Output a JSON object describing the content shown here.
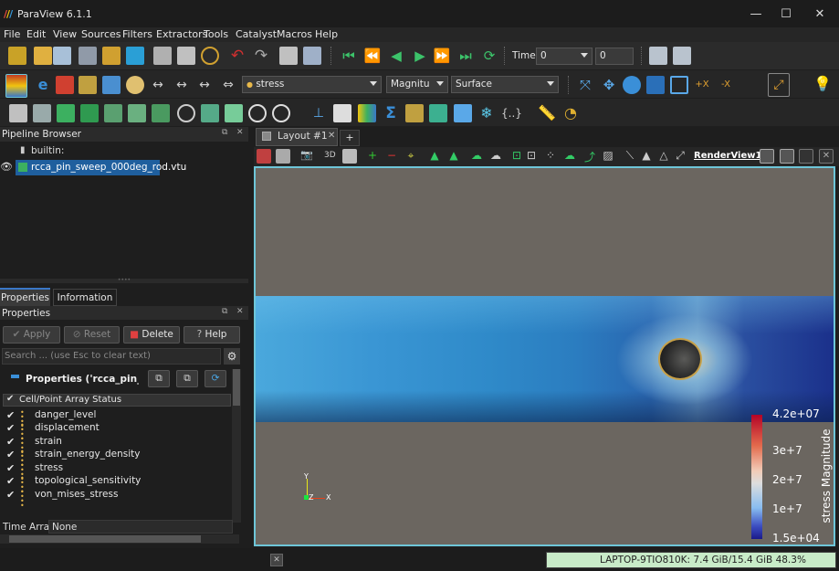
{
  "window": {
    "title": "ParaView 6.1.1",
    "logo": "///",
    "minimize": "—",
    "maximize": "☐",
    "close": "✕"
  },
  "menu": [
    "File",
    "Edit",
    "View",
    "Sources",
    "Filters",
    "Extractors",
    "Tools",
    "Catalyst",
    "Macros",
    "Help"
  ],
  "toolbar": {
    "time_label": "Time:",
    "time_value": "0",
    "timestep_value": "0",
    "array_combo": "stress",
    "component_combo": "Magnitu",
    "representation_combo": "Surface"
  },
  "pipeline": {
    "title": "Pipeline Browser",
    "root": "builtin:",
    "item": "rcca_pin_sweep_000deg_rod.vtu"
  },
  "properties": {
    "tabs": [
      "Properties",
      "Information"
    ],
    "title": "Properties",
    "apply": "Apply",
    "reset": "Reset",
    "delete": "Delete",
    "help": "Help",
    "search_placeholder": "Search ... (use Esc to clear text)",
    "section_title": "Properties ('rcca_pin_sweep",
    "array_header": "Cell/Point Array Status",
    "arrays": [
      "danger_level",
      "displacement",
      "strain",
      "strain_energy_density",
      "stress",
      "topological_sensitivity",
      "von_mises_stress"
    ],
    "time_array_label": "Time Array",
    "time_array_value": "None"
  },
  "layout": {
    "tab_label": "Layout #1",
    "add_tab": "+",
    "render_view": "RenderView1",
    "view_3d": "3D"
  },
  "colorbar": {
    "title": "stress Magnitude",
    "ticks": [
      "4.2e+07",
      "3e+7",
      "2e+7",
      "1e+7",
      "1.5e+04"
    ]
  },
  "axes": {
    "x": "X",
    "y": "Y",
    "z": "Z"
  },
  "status": {
    "memory": "LAPTOP-9TIO810K: 7.4 GiB/15.4 GiB 48.3%",
    "memory_fraction": 0.483
  },
  "colors": {
    "background": "#1e1e1e",
    "render_bg": "#6b6660",
    "selection": "#1f5f9e",
    "accent_border": "#6ec6d8"
  }
}
